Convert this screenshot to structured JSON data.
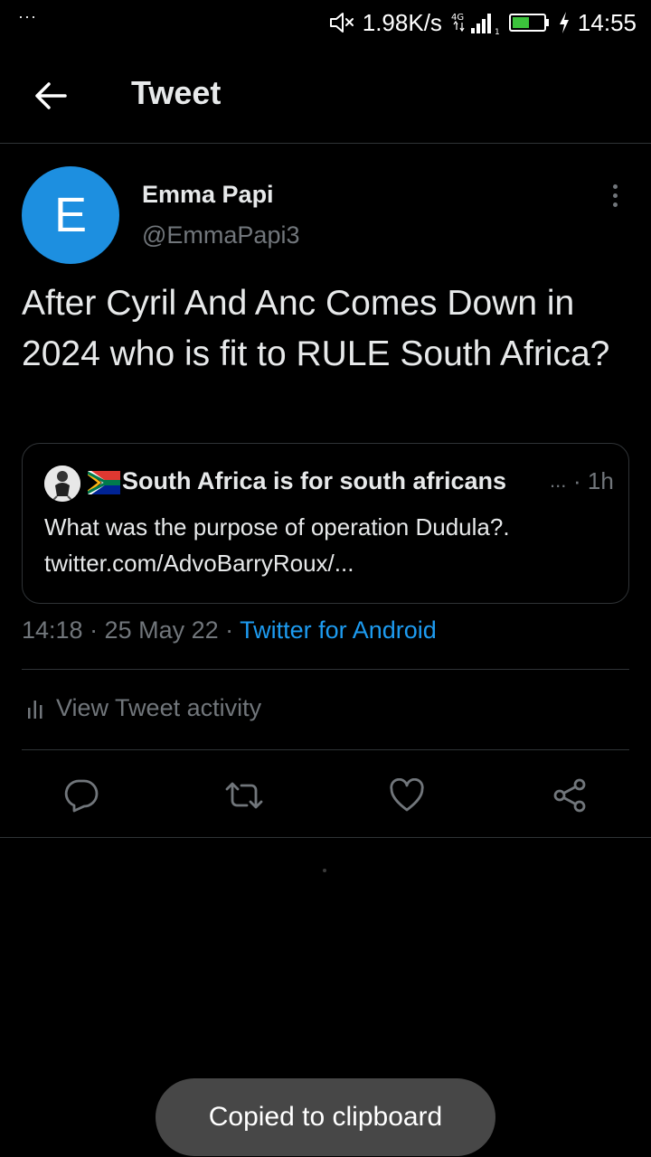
{
  "status_bar": {
    "left_dots": "···",
    "net_speed": "1.98K/s",
    "net_type": "4G",
    "time": "14:55",
    "icons": [
      "mute-icon",
      "signal-icon",
      "battery-icon",
      "charging-icon"
    ]
  },
  "header": {
    "title": "Tweet",
    "back_icon": "arrow-left-icon"
  },
  "tweet": {
    "avatar_letter": "E",
    "author_name": "Emma Papi",
    "author_handle": "@EmmaPapi3",
    "text": "After Cyril And Anc Comes Down in 2024 who is fit to RULE South Africa?",
    "timestamp": "14:18 · 25 May 22 · ",
    "source": "Twitter for Android"
  },
  "quote": {
    "name": "South Africa is for south africans",
    "ellipsis": "...",
    "time": "· 1h",
    "text": "What was the purpose of operation Dudula?. twitter.com/AdvoBarryRoux/..."
  },
  "activity": {
    "label": "View Tweet activity"
  },
  "actions": {
    "icons": [
      "reply-icon",
      "retweet-icon",
      "like-icon",
      "share-icon"
    ]
  },
  "toast": {
    "text": "Copied to clipboard"
  },
  "colors": {
    "background": "#000000",
    "accent": "#1d9bf0",
    "avatar": "#1d8fe0",
    "secondary_text": "#71767b",
    "border": "#2f3336",
    "toast_bg": "#474747"
  }
}
